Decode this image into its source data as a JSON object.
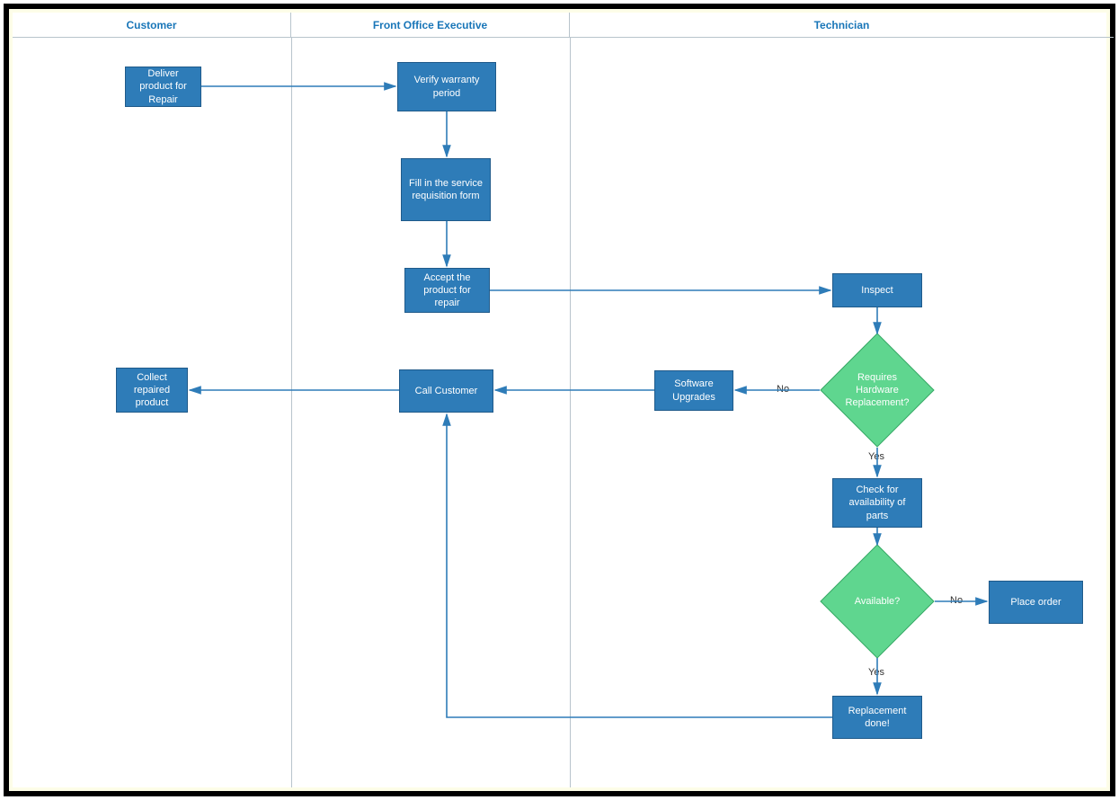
{
  "lanes": {
    "customer": "Customer",
    "frontOffice": "Front Office Executive",
    "technician": "Technician"
  },
  "nodes": {
    "deliver": "Deliver product for Repair",
    "verify": "Verify warranty period",
    "fillForm": "Fill in the service requisition form",
    "accept": "Accept the product for repair",
    "inspect": "Inspect",
    "requiresHw": "Requires Hardware Replacement?",
    "software": "Software Upgrades",
    "callCustomer": "Call Customer",
    "collect": "Collect repaired product",
    "checkParts": "Check for availability of parts",
    "available": "Available?",
    "placeOrder": "Place order",
    "replacement": "Replacement done!"
  },
  "labels": {
    "yes1": "Yes",
    "no1": "No",
    "yes2": "Yes",
    "no2": "No"
  },
  "colors": {
    "process": "#2e7cb8",
    "decision": "#5fd68f",
    "arrow": "#2e7cb8"
  }
}
